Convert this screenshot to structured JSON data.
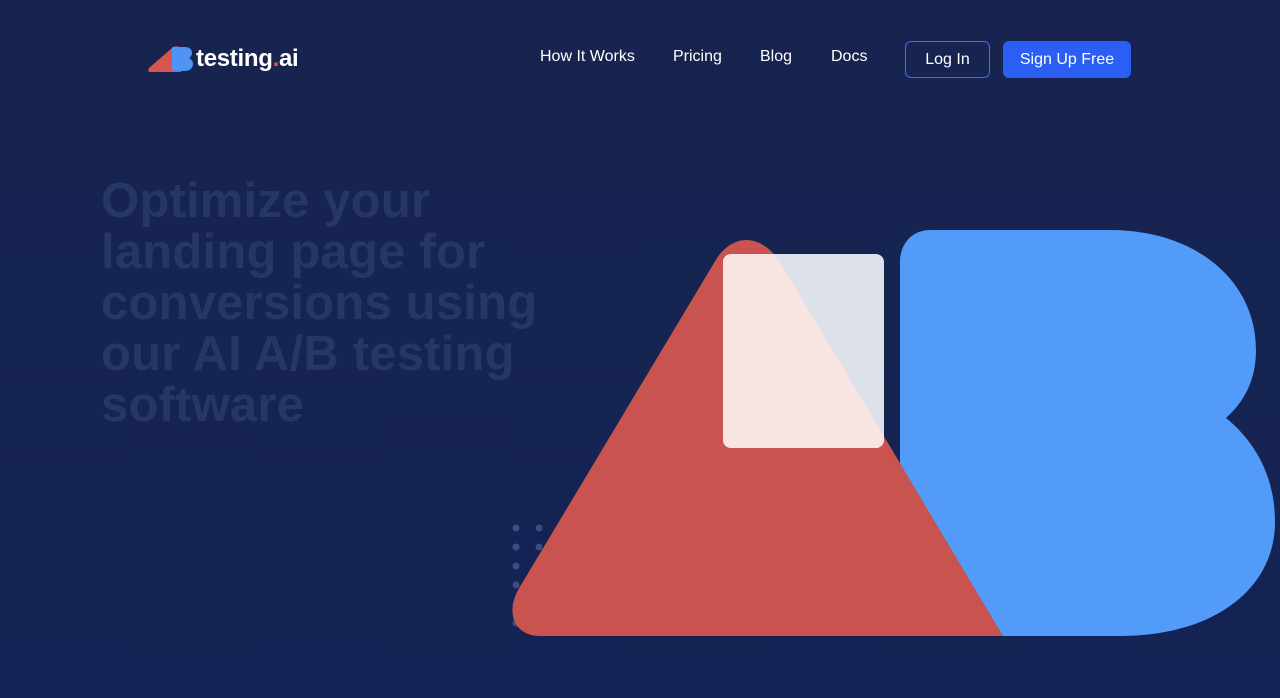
{
  "brand": {
    "name_main": "testing",
    "name_dot": ".",
    "name_suffix": "ai",
    "logo_icon": "ab-logo-icon"
  },
  "nav": {
    "links": [
      {
        "label": "How It Works"
      },
      {
        "label": "Pricing"
      },
      {
        "label": "Blog"
      },
      {
        "label": "Docs"
      }
    ],
    "login_label": "Log In",
    "signup_label": "Sign Up Free"
  },
  "hero": {
    "headline": "Optimize your landing page for conversions using our AI A/B testing software",
    "illustration": "ab-shapes-illustration"
  },
  "colors": {
    "background": "#16244f",
    "accent_blue": "#2a5ef5",
    "shape_red": "#c9534e",
    "shape_blue": "#529bf8",
    "card_white": "#f5f7fb"
  }
}
